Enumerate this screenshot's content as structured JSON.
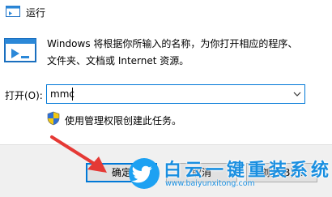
{
  "window": {
    "title": "运行"
  },
  "description": {
    "line1": "Windows 将根据你所输入的名称，为你打开相应的程序、",
    "line2": "文件夹、文档或 Internet 资源。"
  },
  "open_field": {
    "label": "打开(O):",
    "value": "mmc"
  },
  "admin_note": "使用管理权限创建此任务。",
  "buttons": {
    "ok": "确定",
    "cancel": "取消",
    "browse": "浏览(B)..."
  },
  "watermark": {
    "title": "白云一键重装系统",
    "url": "www.baiyunxitong.com"
  },
  "colors": {
    "accent": "#0078d7",
    "annotation_arrow": "#e53935",
    "watermark": "#1a8fe0"
  },
  "icons": [
    "run-window-icon",
    "run-program-icon",
    "dropdown-chevron-icon",
    "uac-shield-icon",
    "twitter-bird-logo-icon",
    "red-pointer-arrow-icon"
  ]
}
